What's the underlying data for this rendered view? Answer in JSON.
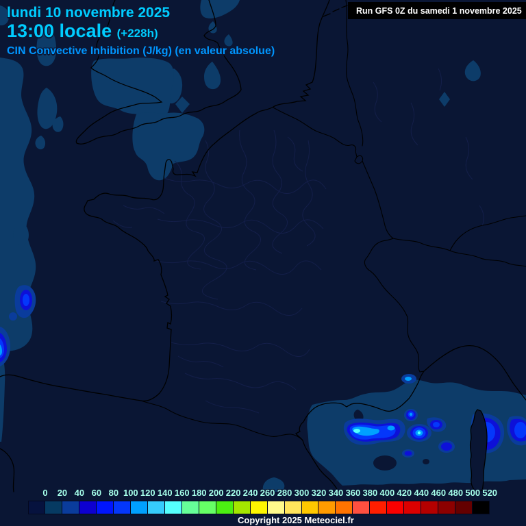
{
  "header": {
    "date_line": "lundi 10 novembre 2025",
    "time_line": "13:00 locale",
    "offset_label": "(+228h)",
    "param_line": "CIN Convective Inhibition (J/kg) (en valeur absolue)"
  },
  "run_info": {
    "label": "Run GFS 0Z du samedi 1 novembre 2025"
  },
  "legend": {
    "unit": "J/kg",
    "values": [
      "0",
      "20",
      "40",
      "60",
      "80",
      "100",
      "120",
      "140",
      "160",
      "180",
      "200",
      "220",
      "240",
      "260",
      "280",
      "300",
      "320",
      "340",
      "360",
      "380",
      "400",
      "420",
      "440",
      "460",
      "480",
      "500",
      "520"
    ],
    "colors": [
      "#06123E",
      "#063A62",
      "#0A3C9C",
      "#0D00D0",
      "#0015FF",
      "#0437FB",
      "#00A0FF",
      "#36CCFC",
      "#55FFFF",
      "#66FF99",
      "#66FF66",
      "#4CEF12",
      "#A4E600",
      "#FDF500",
      "#FFFA8C",
      "#FFE45C",
      "#FFC800",
      "#FF9B00",
      "#FF7300",
      "#FF5040",
      "#FF1E00",
      "#FA0000",
      "#DC0000",
      "#B40000",
      "#8C0000",
      "#640000",
      "#000000"
    ]
  },
  "footer": {
    "copyright": "Copyright 2025 Meteociel.fr"
  },
  "colors": {
    "background": "#0A1634",
    "patch": "#0D3C69",
    "department_line": "#141F4A",
    "coast_line": "#000000",
    "title_cyan": "#00CCFF",
    "param_blue": "#0096FF",
    "legend_label": "#A6FFEA"
  }
}
